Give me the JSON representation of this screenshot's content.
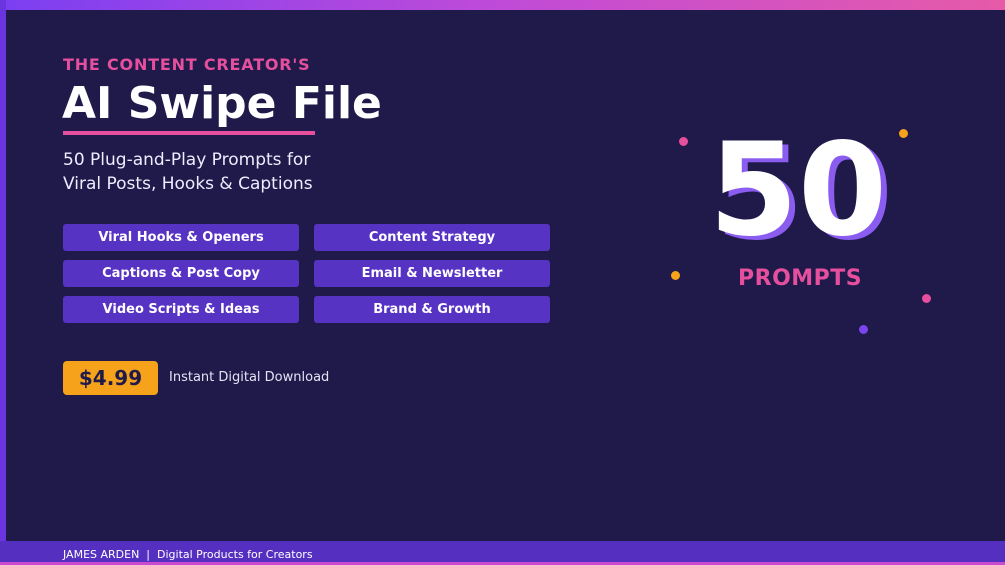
{
  "header": {
    "eyebrow": "THE CONTENT CREATOR'S",
    "title": "AI Swipe File",
    "subtitle_line1": "50 Plug-and-Play Prompts for",
    "subtitle_line2": "Viral Posts, Hooks & Captions"
  },
  "categories": [
    "Viral Hooks & Openers",
    "Content Strategy",
    "Captions & Post Copy",
    "Email & Newsletter",
    "Video Scripts & Ideas",
    "Brand & Growth"
  ],
  "offer": {
    "price": "$4.99",
    "note": "Instant Digital Download"
  },
  "hero": {
    "count": "50",
    "label": "PROMPTS"
  },
  "footer": {
    "text": "JAMES ARDEN  |  Digital Products for Creators"
  },
  "colors": {
    "background": "#1f1a4a",
    "accent_pink": "#e64f9d",
    "accent_purple": "#5733c4",
    "accent_orange": "#f6a21a"
  }
}
